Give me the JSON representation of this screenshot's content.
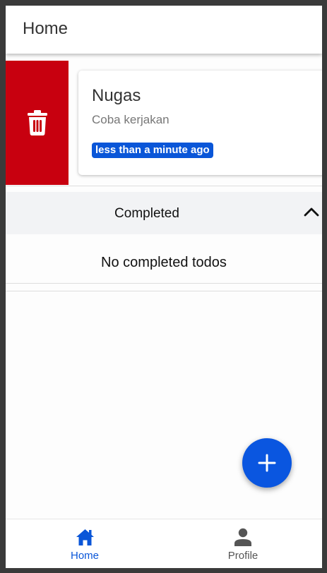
{
  "appbar": {
    "title": "Home"
  },
  "todos": [
    {
      "title": "Nugas",
      "description": "Coba kerjakan",
      "time": "less than a minute ago"
    }
  ],
  "delete_action": {
    "icon": "trash-icon",
    "color": "#c8000f"
  },
  "completed": {
    "label": "Completed",
    "icon": "chevron-up-icon",
    "empty_text": "No completed todos"
  },
  "fab": {
    "icon": "plus-icon",
    "color": "#0a56e0"
  },
  "bottom_nav": {
    "items": [
      {
        "label": "Home",
        "icon": "home-icon",
        "active": true
      },
      {
        "label": "Profile",
        "icon": "person-icon",
        "active": false
      }
    ]
  },
  "colors": {
    "accent": "#0a56d8"
  }
}
